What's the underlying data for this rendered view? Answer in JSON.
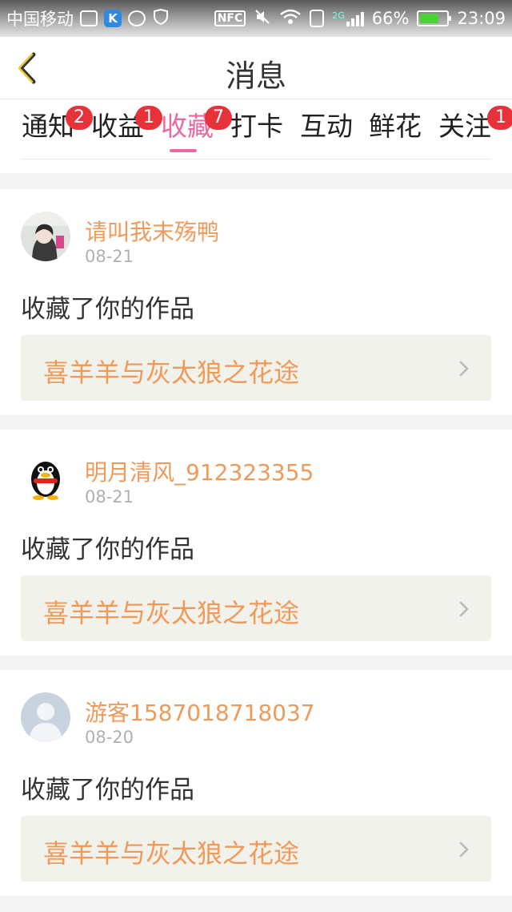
{
  "statusbar": {
    "carrier": "中国移动",
    "network": "2G",
    "battery": "66%",
    "time": "23:09",
    "icons": [
      "image-icon",
      "k-app-icon",
      "browser-icon",
      "vpn-shield-icon",
      "nfc-icon",
      "mute-icon",
      "wifi-icon",
      "sim-icon",
      "signal-icon",
      "battery-charging-icon"
    ]
  },
  "header": {
    "title": "消息",
    "back_icon": "chevron-left-icon"
  },
  "tabs": [
    {
      "label": "通知",
      "badge": "2"
    },
    {
      "label": "收益",
      "badge": "1"
    },
    {
      "label": "收藏",
      "badge": "7",
      "active": true
    },
    {
      "label": "打卡",
      "badge": ""
    },
    {
      "label": "互动",
      "badge": ""
    },
    {
      "label": "鲜花",
      "badge": ""
    },
    {
      "label": "关注",
      "badge": "1"
    }
  ],
  "messages": [
    {
      "username": "请叫我末殇鸭",
      "date": "08-21",
      "action": "收藏了你的作品",
      "work_title": "喜羊羊与灰太狼之花途",
      "avatar": "anime-girl-avatar"
    },
    {
      "username": "明月清风_912323355",
      "date": "08-21",
      "action": "收藏了你的作品",
      "work_title": "喜羊羊与灰太狼之花途",
      "avatar": "qq-penguin-avatar"
    },
    {
      "username": "游客1587018718037",
      "date": "08-20",
      "action": "收藏了你的作品",
      "work_title": "喜羊羊与灰太狼之花途",
      "avatar": "default-user-avatar"
    }
  ],
  "colors": {
    "accent": "#e86aa0",
    "username": "#f09a5a",
    "badge": "#e8323a",
    "work_bg": "#f2f2ec"
  }
}
